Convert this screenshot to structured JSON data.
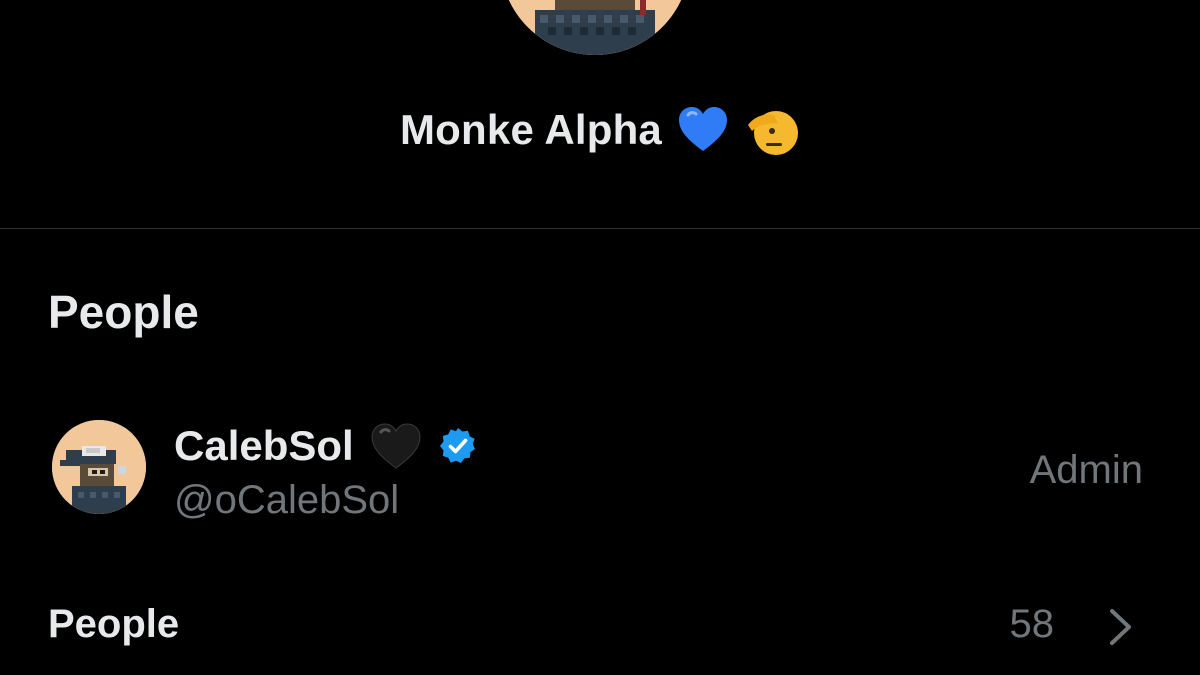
{
  "group": {
    "name": "Monke Alpha",
    "name_emojis": [
      "blue-heart-icon",
      "saluting-face-icon"
    ]
  },
  "people_section": {
    "title": "People"
  },
  "members": [
    {
      "display_name": "CalebSol",
      "name_emoji": "black-heart-icon",
      "verified": true,
      "handle": "@oCalebSol",
      "role": "Admin"
    }
  ],
  "people_link": {
    "label": "People",
    "count": "58"
  },
  "colors": {
    "background": "#000000",
    "primary_text": "#e7e9ea",
    "secondary_text": "#71767b",
    "divider": "#2f3336",
    "verified_blue": "#1d9bf0",
    "heart_blue": "#2f7cf6"
  }
}
